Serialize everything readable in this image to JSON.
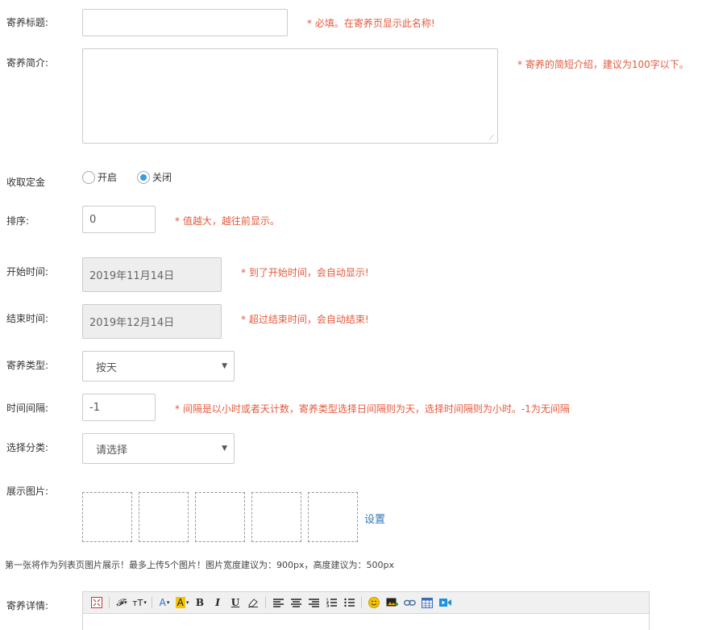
{
  "form": {
    "title": {
      "label": "寄养标题:",
      "value": "",
      "hint": "* 必填。在寄养页显示此名称!"
    },
    "intro": {
      "label": "寄养简介:",
      "value": "",
      "hint": "* 寄养的简短介绍，建议为100字以下。"
    },
    "deposit": {
      "label": "收取定金",
      "options": [
        "开启",
        "关闭"
      ],
      "selected": "关闭"
    },
    "sort": {
      "label": "排序:",
      "value": "0",
      "hint": "* 值越大，越往前显示。"
    },
    "start_time": {
      "label": "开始时间:",
      "value": "2019年11月14日",
      "hint": "* 到了开始时间，会自动显示!"
    },
    "end_time": {
      "label": "结束时间:",
      "value": "2019年12月14日",
      "hint": "* 超过结束时间，会自动结束!"
    },
    "type": {
      "label": "寄养类型:",
      "value": "按天"
    },
    "interval": {
      "label": "时间间隔:",
      "value": "-1",
      "hint": "* 间隔是以小时或者天计数，寄养类型选择日间隔则为天，选择时间隔则为小时。-1为无间隔"
    },
    "category": {
      "label": "选择分类:",
      "value": "请选择"
    },
    "images": {
      "label": "展示图片:",
      "count": 5,
      "set_link": "设置",
      "note": "第一张将作为列表页图片展示！最多上传5个图片！图片宽度建议为：900px，高度建议为：500px"
    },
    "detail": {
      "label": "寄养详情:"
    }
  },
  "editor_toolbar": {
    "icons": [
      "fullscreen-icon",
      "font-family-icon",
      "font-size-icon",
      "font-color-icon",
      "highlight-icon",
      "bold-icon",
      "italic-icon",
      "underline-icon",
      "eraser-icon",
      "align-left-icon",
      "align-center-icon",
      "align-right-icon",
      "ordered-list-icon",
      "unordered-list-icon",
      "emoji-icon",
      "insert-image-icon",
      "link-icon",
      "table-icon",
      "video-icon"
    ],
    "glyphs": {
      "bold": "B",
      "italic": "I",
      "underline": "U",
      "font_color": "A",
      "highlight": "A",
      "font_size": "тT",
      "font_family": "𝓕"
    }
  },
  "colors": {
    "hint": "#e4593c",
    "radio_checked": "#3c9bd8",
    "link": "#2d79b8"
  }
}
